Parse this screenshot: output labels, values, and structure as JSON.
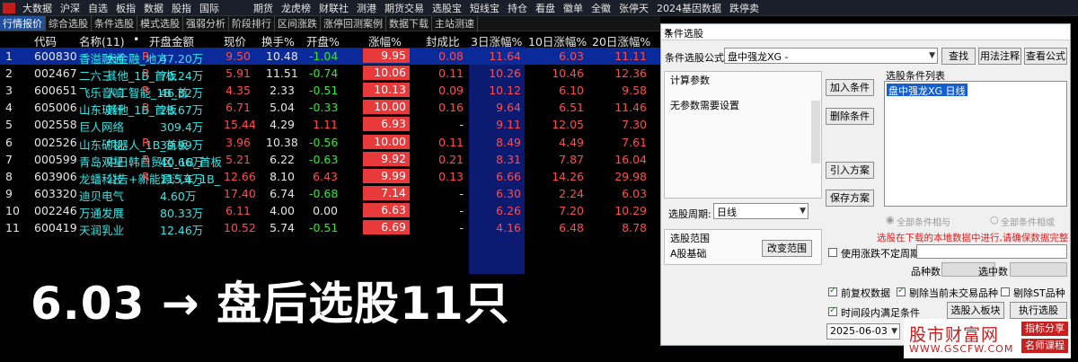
{
  "menu": {
    "items": [
      "大数据",
      "沪深",
      "自选",
      "板指",
      "数据",
      "股指",
      "国际",
      "期货",
      "龙虎榜",
      "财联社",
      "测港",
      "期货交易",
      "选股宝",
      "短线宝",
      "持仓",
      "看盘",
      "徽单",
      "全徽",
      "张停天",
      "2024基因数据",
      "跌停卖"
    ]
  },
  "subtabs": [
    "行情报价",
    "综合选股",
    "条件选股",
    "模式选股",
    "强弱分析",
    "阶段排行",
    "区间涨跌",
    "涨停回测案例",
    "数据下载",
    "主站测速"
  ],
  "table": {
    "headers": [
      "代码",
      "名称(11)",
      "•",
      "开盘金额",
      "现价",
      "换手%",
      "开盘%",
      "涨幅%",
      "封成比",
      "3日涨幅%",
      "10日涨幅%",
      "20日涨幅%"
    ],
    "rows": [
      {
        "n": "1",
        "code": "600830",
        "name": "香溢融通",
        "tag": "大金融_地方",
        "open_amt": "47.20万",
        "price": "9.50",
        "turn": "10.48",
        "open_pct": "-1.04",
        "chg": "9.95",
        "seal": "0.08",
        "d3": "11.64",
        "d10": "6.03",
        "d20": "11.11"
      },
      {
        "n": "2",
        "code": "002467",
        "name": "二六三",
        "tag": "其他_1B_首板",
        "open_amt": "70.24万",
        "price": "5.91",
        "turn": "11.51",
        "open_pct": "-0.74",
        "chg": "10.06",
        "seal": "0.11",
        "d3": "10.26",
        "d10": "10.46",
        "d20": "12.36"
      },
      {
        "n": "3",
        "code": "600651",
        "name": "飞乐音响",
        "tag": "人工智能_1B_首",
        "open_amt": "46.82万",
        "price": "4.35",
        "turn": "2.33",
        "open_pct": "-0.51",
        "chg": "10.13",
        "seal": "0.09",
        "d3": "10.12",
        "d10": "6.10",
        "d20": "9.58"
      },
      {
        "n": "4",
        "code": "605006",
        "name": "山东玻纤",
        "tag": "其他_1B_首板",
        "open_amt": "28.67万",
        "price": "6.71",
        "turn": "5.04",
        "open_pct": "-0.33",
        "chg": "10.00",
        "seal": "0.16",
        "d3": "9.64",
        "d10": "6.51",
        "d20": "11.46"
      },
      {
        "n": "5",
        "code": "002558",
        "name": "巨人网络",
        "tag": "",
        "open_amt": "309.4万",
        "price": "15.44",
        "turn": "4.29",
        "open_pct": "1.11",
        "chg": "6.93",
        "seal": "-",
        "d3": "9.11",
        "d10": "12.05",
        "d20": "7.30"
      },
      {
        "n": "6",
        "code": "002526",
        "name": "山东矿机",
        "tag": "机器人_1B_首板",
        "open_amt": "39.99万",
        "price": "3.96",
        "turn": "10.38",
        "open_pct": "-0.56",
        "chg": "10.00",
        "seal": "0.11",
        "d3": "8.49",
        "d10": "4.49",
        "d20": "7.61"
      },
      {
        "n": "7",
        "code": "000599",
        "name": "青岛双星",
        "tag": "中日韩自贸区_1B_首板",
        "open_amt": "40.66万",
        "price": "5.21",
        "turn": "6.22",
        "open_pct": "-0.63",
        "chg": "9.92",
        "seal": "0.21",
        "d3": "8.31",
        "d10": "7.87",
        "d20": "16.04"
      },
      {
        "n": "8",
        "code": "603906",
        "name": "龙蟠科技",
        "tag": "公告+新能源汽车_1B_",
        "open_amt": "115.4万",
        "price": "12.66",
        "turn": "8.10",
        "open_pct": "6.43",
        "chg": "9.99",
        "seal": "0.13",
        "d3": "6.66",
        "d10": "14.26",
        "d20": "29.98"
      },
      {
        "n": "9",
        "code": "603320",
        "name": "迪贝电气",
        "tag": "",
        "open_amt": "4.60万",
        "price": "17.40",
        "turn": "6.74",
        "open_pct": "-0.68",
        "chg": "7.14",
        "seal": "-",
        "d3": "6.30",
        "d10": "2.24",
        "d20": "6.03"
      },
      {
        "n": "10",
        "code": "002246",
        "name": "万通发展",
        "tag": "",
        "open_amt": "80.33万",
        "price": "6.11",
        "turn": "4.00",
        "open_pct": "0.00",
        "chg": "6.63",
        "seal": "-",
        "d3": "6.26",
        "d10": "7.20",
        "d20": "10.29"
      },
      {
        "n": "11",
        "code": "600419",
        "name": "天润乳业",
        "tag": "",
        "open_amt": "12.46万",
        "price": "10.52",
        "turn": "5.74",
        "open_pct": "-0.51",
        "chg": "6.69",
        "seal": "-",
        "d3": "4.16",
        "d10": "6.48",
        "d20": "8.78"
      }
    ]
  },
  "caption": "6.03 → 盘后选股11只",
  "dialog": {
    "title": "条件选股",
    "formula_label": "条件选股公式",
    "formula_value": "盘中强龙XG  -",
    "btn_find": "查找",
    "btn_usage": "用法注释",
    "btn_view": "查看公式",
    "calc_params": "计算参数",
    "no_params": "无参数需要设置",
    "list_title": "选股条件列表",
    "list_item": "盘中强龙XG  日线",
    "btn_add": "加入条件",
    "btn_del": "删除条件",
    "btn_import": "引入方案",
    "btn_save": "保存方案",
    "period_label": "选股周期:",
    "period_value": "日线",
    "radio_and": "全部条件相与",
    "radio_or": "全部条件相或",
    "range_title": "选股范围",
    "range_value": "A股基础",
    "btn_change": "改变范围",
    "notice": "选股在下载的本地数据中进行,请确保数据完整",
    "chk_varperiod": "使用涨跌不定周期",
    "stock_count": "品种数",
    "selected_count": "选中数",
    "chk_restore": "前复权数据",
    "chk_notrade": "剔除当前未交易品种",
    "chk_st": "剔除ST品种",
    "chk_timerange": "时间段内满足条件",
    "date": "2025-06-03",
    "btn_into": "选股入板块",
    "btn_exec": "执行选股"
  },
  "watermark": {
    "title": "股市财富网",
    "url": "WWW.GSCFW.COM",
    "tag1": "指标分享",
    "tag2": "名师课程"
  }
}
